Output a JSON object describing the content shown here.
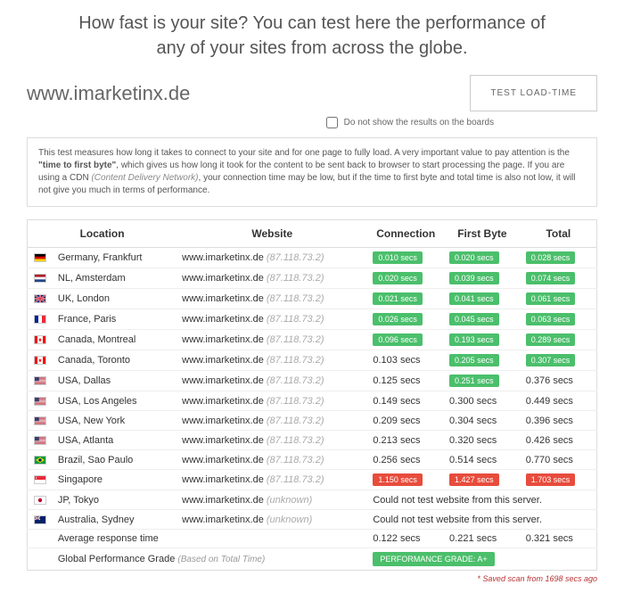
{
  "heading": "How fast is your site? You can test here the performance of any of your sites from across the globe.",
  "url_value": "www.imarketinx.de",
  "test_button": "TEST LOAD-TIME",
  "dont_show_label": "Do not show the results on the boards",
  "info_pre": "This test measures how long it takes to connect to your site and for one page to fully load. A very important value to pay attention is the ",
  "info_strong": "\"time to first byte\"",
  "info_mid": ", which gives us how long it took for the content to be sent back to browser to start processing the page. If you are using a CDN ",
  "info_cdn": "(Content Delivery Network)",
  "info_post": ", your connection time may be low, but if the time to first byte and total time is also not low, it will not give you much in terms of performance.",
  "columns": {
    "location": "Location",
    "website": "Website",
    "connection": "Connection",
    "first_byte": "First Byte",
    "total": "Total"
  },
  "rows": [
    {
      "flag": "de",
      "location": "Germany, Frankfurt",
      "site": "www.imarketinx.de",
      "ip": "(87.118.73.2)",
      "conn": "0.010 secs",
      "conn_c": "green",
      "fb": "0.020 secs",
      "fb_c": "green",
      "tot": "0.028 secs",
      "tot_c": "green"
    },
    {
      "flag": "nl",
      "location": "NL, Amsterdam",
      "site": "www.imarketinx.de",
      "ip": "(87.118.73.2)",
      "conn": "0.020 secs",
      "conn_c": "green",
      "fb": "0.039 secs",
      "fb_c": "green",
      "tot": "0.074 secs",
      "tot_c": "green"
    },
    {
      "flag": "uk",
      "location": "UK, London",
      "site": "www.imarketinx.de",
      "ip": "(87.118.73.2)",
      "conn": "0.021 secs",
      "conn_c": "green",
      "fb": "0.041 secs",
      "fb_c": "green",
      "tot": "0.061 secs",
      "tot_c": "green"
    },
    {
      "flag": "fr",
      "location": "France, Paris",
      "site": "www.imarketinx.de",
      "ip": "(87.118.73.2)",
      "conn": "0.026 secs",
      "conn_c": "green",
      "fb": "0.045 secs",
      "fb_c": "green",
      "tot": "0.063 secs",
      "tot_c": "green"
    },
    {
      "flag": "ca",
      "location": "Canada, Montreal",
      "site": "www.imarketinx.de",
      "ip": "(87.118.73.2)",
      "conn": "0.096 secs",
      "conn_c": "green",
      "fb": "0.193 secs",
      "fb_c": "green",
      "tot": "0.289 secs",
      "tot_c": "green"
    },
    {
      "flag": "ca",
      "location": "Canada, Toronto",
      "site": "www.imarketinx.de",
      "ip": "(87.118.73.2)",
      "conn": "0.103 secs",
      "conn_c": "plain",
      "fb": "0.205 secs",
      "fb_c": "green",
      "tot": "0.307 secs",
      "tot_c": "green"
    },
    {
      "flag": "us",
      "location": "USA, Dallas",
      "site": "www.imarketinx.de",
      "ip": "(87.118.73.2)",
      "conn": "0.125 secs",
      "conn_c": "plain",
      "fb": "0.251 secs",
      "fb_c": "green",
      "tot": "0.376 secs",
      "tot_c": "plain"
    },
    {
      "flag": "us",
      "location": "USA, Los Angeles",
      "site": "www.imarketinx.de",
      "ip": "(87.118.73.2)",
      "conn": "0.149 secs",
      "conn_c": "plain",
      "fb": "0.300 secs",
      "fb_c": "plain",
      "tot": "0.449 secs",
      "tot_c": "plain"
    },
    {
      "flag": "us",
      "location": "USA, New York",
      "site": "www.imarketinx.de",
      "ip": "(87.118.73.2)",
      "conn": "0.209 secs",
      "conn_c": "plain",
      "fb": "0.304 secs",
      "fb_c": "plain",
      "tot": "0.396 secs",
      "tot_c": "plain"
    },
    {
      "flag": "us",
      "location": "USA, Atlanta",
      "site": "www.imarketinx.de",
      "ip": "(87.118.73.2)",
      "conn": "0.213 secs",
      "conn_c": "plain",
      "fb": "0.320 secs",
      "fb_c": "plain",
      "tot": "0.426 secs",
      "tot_c": "plain"
    },
    {
      "flag": "br",
      "location": "Brazil, Sao Paulo",
      "site": "www.imarketinx.de",
      "ip": "(87.118.73.2)",
      "conn": "0.256 secs",
      "conn_c": "plain",
      "fb": "0.514 secs",
      "fb_c": "plain",
      "tot": "0.770 secs",
      "tot_c": "plain"
    },
    {
      "flag": "sg",
      "location": "Singapore",
      "site": "www.imarketinx.de",
      "ip": "(87.118.73.2)",
      "conn": "1.150 secs",
      "conn_c": "red",
      "fb": "1.427 secs",
      "fb_c": "red",
      "tot": "1.703 secs",
      "tot_c": "red"
    },
    {
      "flag": "jp",
      "location": "JP, Tokyo",
      "site": "www.imarketinx.de",
      "ip": "(unknown)",
      "fail_msg": "Could not test website from this server."
    },
    {
      "flag": "au",
      "location": "Australia, Sydney",
      "site": "www.imarketinx.de",
      "ip": "(unknown)",
      "fail_msg": "Could not test website from this server."
    }
  ],
  "avg_label": "Average response time",
  "avg": {
    "conn": "0.122 secs",
    "fb": "0.221 secs",
    "tot": "0.321 secs"
  },
  "grade_label": "Global Performance Grade",
  "grade_based": "(Based on Total Time)",
  "grade_badge": "PERFORMANCE GRADE:  A+",
  "footnote": "* Saved scan from 1698 secs ago"
}
